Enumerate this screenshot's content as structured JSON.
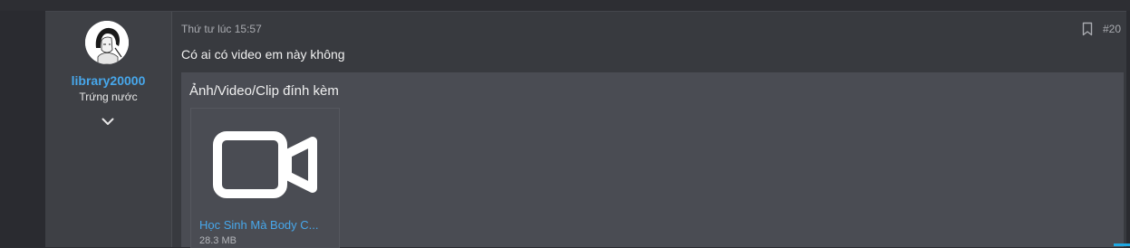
{
  "post": {
    "username": "library20000",
    "user_title": "Trứng nước",
    "date": "Thứ tư lúc 15:57",
    "post_number": "#20",
    "message": "Có ai có video em này không",
    "attachments": {
      "title": "Ảnh/Video/Clip đính kèm",
      "items": [
        {
          "name": "Học Sinh Mà Body C...",
          "size": "28.3 MB",
          "icon": "video-camera-icon"
        }
      ]
    }
  },
  "colors": {
    "background": "#2a2b30",
    "post_bg": "#383a3f",
    "user_col_bg": "#3e4045",
    "attach_bg": "#4a4c53",
    "link": "#47a7eb",
    "accent": "#1ea7e1"
  }
}
